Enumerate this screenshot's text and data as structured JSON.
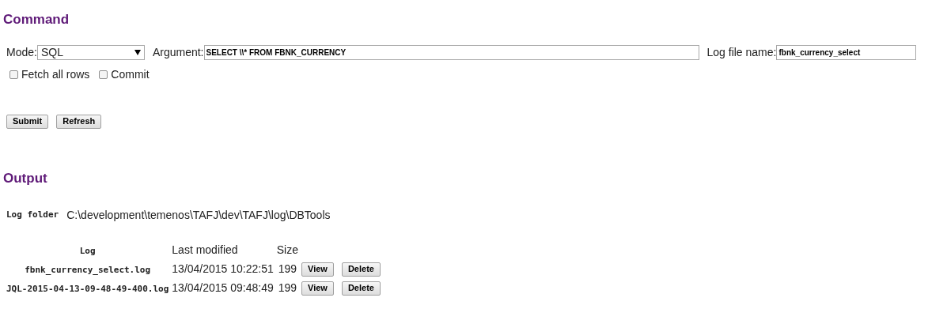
{
  "command": {
    "title": "Command",
    "mode": {
      "label": "Mode:",
      "value": "SQL"
    },
    "argument": {
      "label": "Argument:",
      "value": "SELECT \\\\* FROM FBNK_CURRENCY"
    },
    "log_file": {
      "label": "Log file name:",
      "value": "fbnk_currency_select"
    },
    "options": [
      {
        "label": "Fetch all rows",
        "checked": false
      },
      {
        "label": "Commit",
        "checked": false
      }
    ],
    "buttons": [
      "Submit",
      "Refresh"
    ]
  },
  "output": {
    "title": "Output",
    "log_folder": {
      "label": "Log folder",
      "value": "C:\\development\\temenos\\TAFJ\\dev\\TAFJ\\log\\DBTools"
    },
    "table": {
      "columns": [
        "Log",
        "Last modified",
        "Size"
      ],
      "rows": [
        {
          "log": "fbnk_currency_select.log",
          "modified": "13/04/2015 10:22:51",
          "size": "199",
          "actions": [
            "View",
            "Delete"
          ]
        },
        {
          "log": "JQL-2015-04-13-09-48-49-400.log",
          "modified": "13/04/2015 09:48:49",
          "size": "199",
          "actions": [
            "View",
            "Delete"
          ]
        }
      ]
    }
  }
}
